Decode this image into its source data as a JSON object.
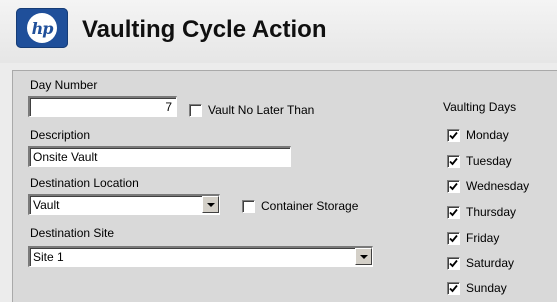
{
  "header": {
    "logo_text": "hp",
    "title": "Vaulting Cycle Action"
  },
  "form": {
    "day_number": {
      "label": "Day Number",
      "value": "7"
    },
    "vault_no_later_than": {
      "label": "Vault No Later Than",
      "checked": false
    },
    "description": {
      "label": "Description",
      "value": "Onsite Vault"
    },
    "destination_location": {
      "label": "Destination Location",
      "value": "Vault"
    },
    "container_storage": {
      "label": "Container Storage",
      "checked": false
    },
    "destination_site": {
      "label": "Destination Site",
      "value": "Site 1"
    }
  },
  "vaulting_days": {
    "label": "Vaulting Days",
    "days": [
      {
        "label": "Monday",
        "checked": true
      },
      {
        "label": "Tuesday",
        "checked": true
      },
      {
        "label": "Wednesday",
        "checked": true
      },
      {
        "label": "Thursday",
        "checked": true
      },
      {
        "label": "Friday",
        "checked": true
      },
      {
        "label": "Saturday",
        "checked": true
      },
      {
        "label": "Sunday",
        "checked": true
      }
    ]
  },
  "icons": {
    "dropdown": "chevron-down-icon",
    "check": "checkmark-icon"
  }
}
